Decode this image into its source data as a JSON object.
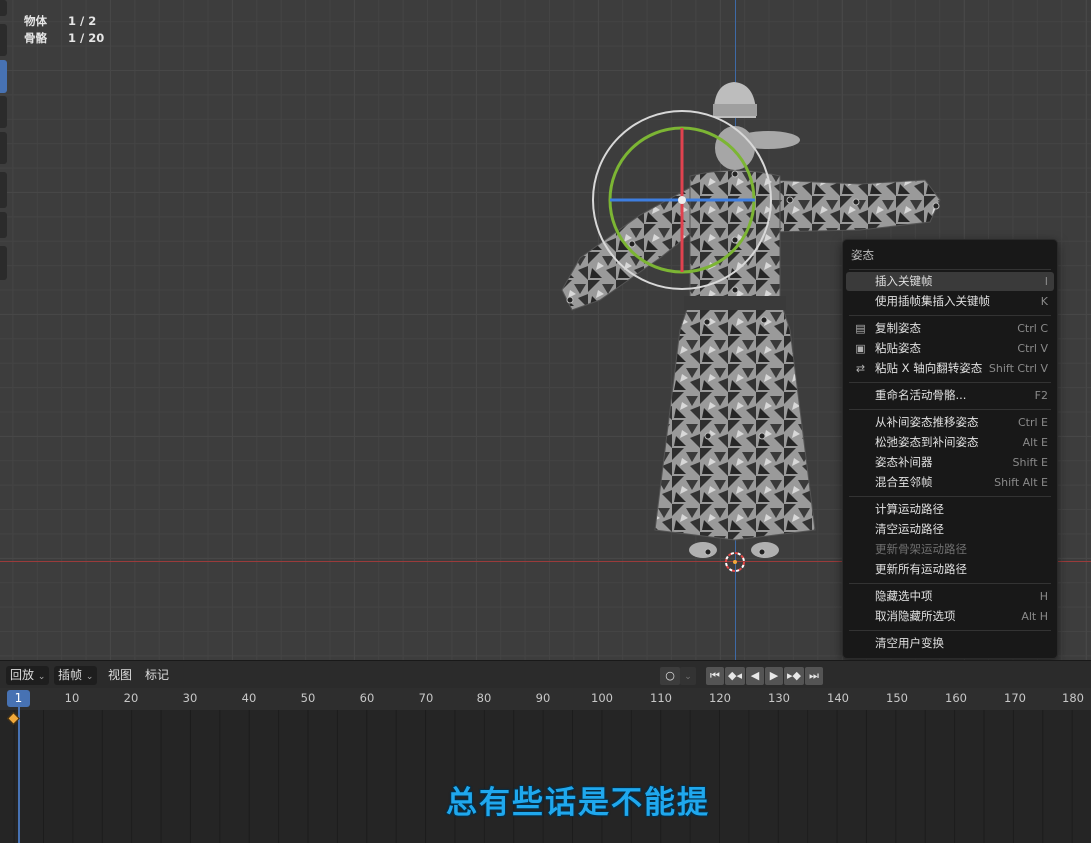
{
  "stats": [
    {
      "label": "物体",
      "value": "1 / 2"
    },
    {
      "label": "骨骼",
      "value": "1 / 20"
    }
  ],
  "menu": {
    "title": "姿态",
    "items": [
      {
        "label": "插入关键帧",
        "shortcut": "I",
        "icon": ""
      },
      {
        "label": "使用插帧集插入关键帧",
        "shortcut": "K",
        "icon": ""
      },
      {
        "label": "复制姿态",
        "shortcut": "Ctrl C",
        "icon": "copy-pose-icon"
      },
      {
        "label": "粘贴姿态",
        "shortcut": "Ctrl V",
        "icon": "paste-pose-icon"
      },
      {
        "label": "粘贴 X 轴向翻转姿态",
        "shortcut": "Shift Ctrl V",
        "icon": "paste-flipped-icon"
      },
      {
        "label": "重命名活动骨骼...",
        "shortcut": "F2",
        "icon": ""
      },
      {
        "label": "从补间姿态推移姿态",
        "shortcut": "Ctrl E",
        "icon": ""
      },
      {
        "label": "松弛姿态到补间姿态",
        "shortcut": "Alt E",
        "icon": ""
      },
      {
        "label": "姿态补间器",
        "shortcut": "Shift E",
        "icon": ""
      },
      {
        "label": "混合至邻帧",
        "shortcut": "Shift Alt E",
        "icon": ""
      },
      {
        "label": "计算运动路径",
        "shortcut": "",
        "icon": ""
      },
      {
        "label": "清空运动路径",
        "shortcut": "",
        "icon": ""
      },
      {
        "label": "更新骨架运动路径",
        "shortcut": "",
        "icon": ""
      },
      {
        "label": "更新所有运动路径",
        "shortcut": "",
        "icon": ""
      },
      {
        "label": "隐藏选中项",
        "shortcut": "H",
        "icon": ""
      },
      {
        "label": "取消隐藏所选项",
        "shortcut": "Alt H",
        "icon": ""
      },
      {
        "label": "清空用户变换",
        "shortcut": "",
        "icon": ""
      }
    ]
  },
  "timeline": {
    "playback": "回放",
    "keying": "插帧",
    "view": "视图",
    "marker": "标记",
    "current_frame": "1",
    "ticks": [
      "10",
      "20",
      "30",
      "40",
      "50",
      "60",
      "70",
      "80",
      "90",
      "100",
      "110",
      "120",
      "130",
      "140",
      "150",
      "160",
      "170",
      "180"
    ]
  },
  "subtitle": "总有些话是不能提",
  "colors": {
    "accent": "#4772b3",
    "keyframe": "#f0a83a",
    "subtitle": "#1fa8ee"
  }
}
